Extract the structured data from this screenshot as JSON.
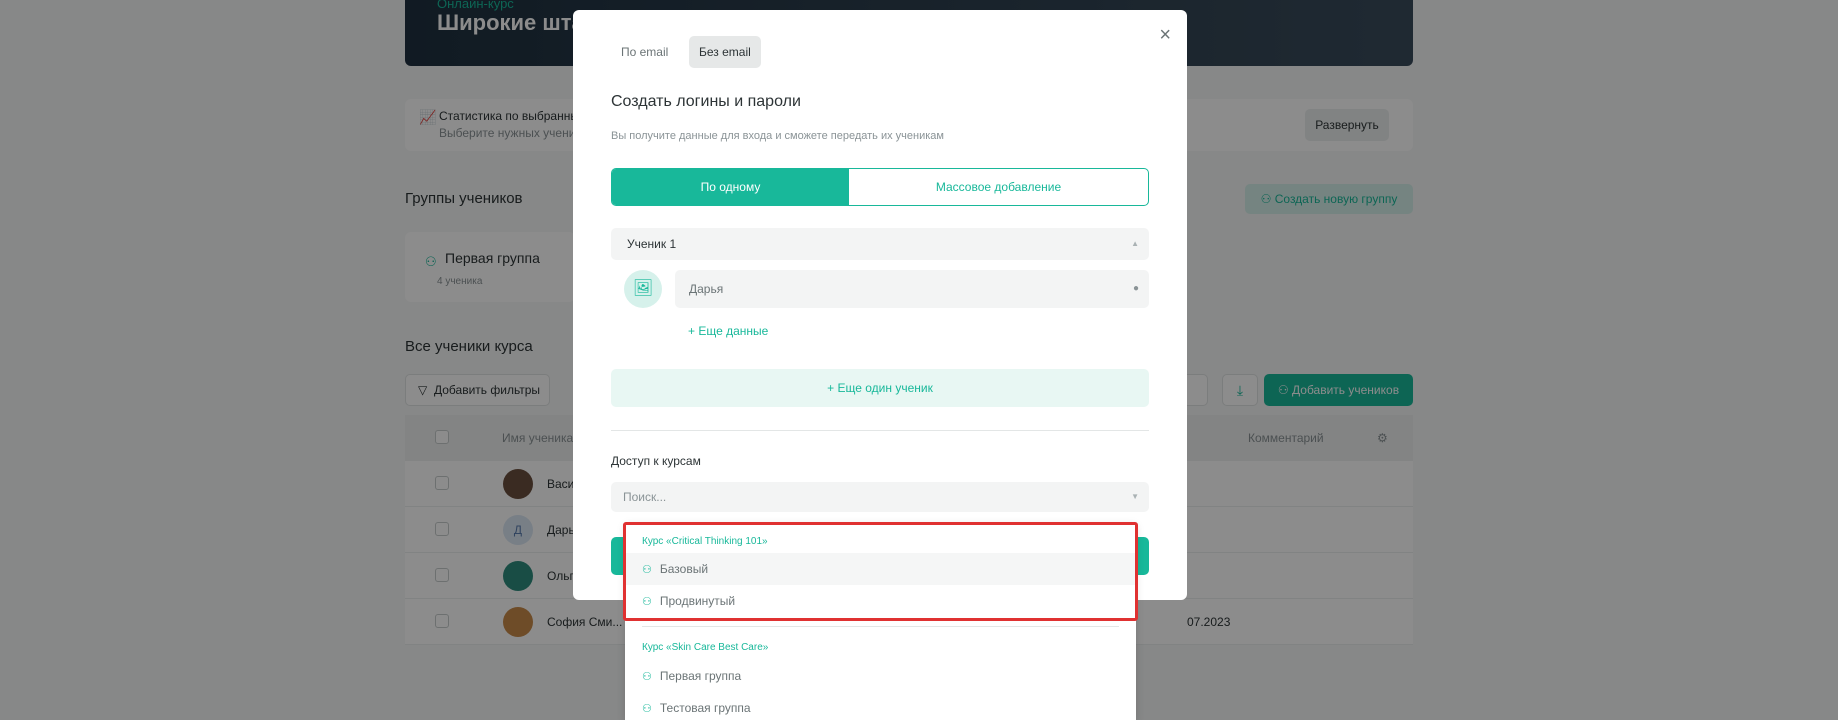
{
  "background": {
    "hero_sub": "Онлайн-курс",
    "hero_title": "Широкие штаны",
    "stats_text": "Статистика по выбранным",
    "stats_hint": "Выберите нужных учеников",
    "expand_label": "Развернуть",
    "groups_title": "Группы учеников",
    "create_group_label": "Создать новую группу",
    "group_name": "Первая группа",
    "group_count": "4 ученика",
    "all_students_title": "Все ученики курса",
    "filters_label": "Добавить фильтры",
    "add_students_label": "Добавить учеников",
    "col_name": "Имя ученика",
    "col_comment": "Комментарий",
    "rows": [
      {
        "name": "Васи",
        "date": ""
      },
      {
        "name": "Дарь",
        "date": ""
      },
      {
        "name": "Ольг",
        "date": ""
      },
      {
        "name": "София Сми...",
        "date": "07.2023"
      }
    ]
  },
  "modal": {
    "tab_email": "По email",
    "tab_no_email": "Без email",
    "title": "Создать логины и пароли",
    "description": "Вы получите данные для входа и сможете передать их ученикам",
    "seg_single": "По одному",
    "seg_bulk": "Массовое добавление",
    "student_label": "Ученик 1",
    "name_value": "Дарья",
    "more_data": "+ Еще данные",
    "add_student": "+ Еще один ученик",
    "access_label": "Доступ к курсам",
    "search_placeholder": "Поиск..."
  },
  "dropdown": {
    "course1": "Курс «Critical Thinking 101»",
    "course1_items": [
      "Базовый",
      "Продвинутый"
    ],
    "course2": "Курс «Skin Care Best Care»",
    "course2_items": [
      "Первая группа",
      "Тестовая группа"
    ]
  },
  "colors": {
    "accent": "#18b89a",
    "highlight": "#e03131"
  }
}
